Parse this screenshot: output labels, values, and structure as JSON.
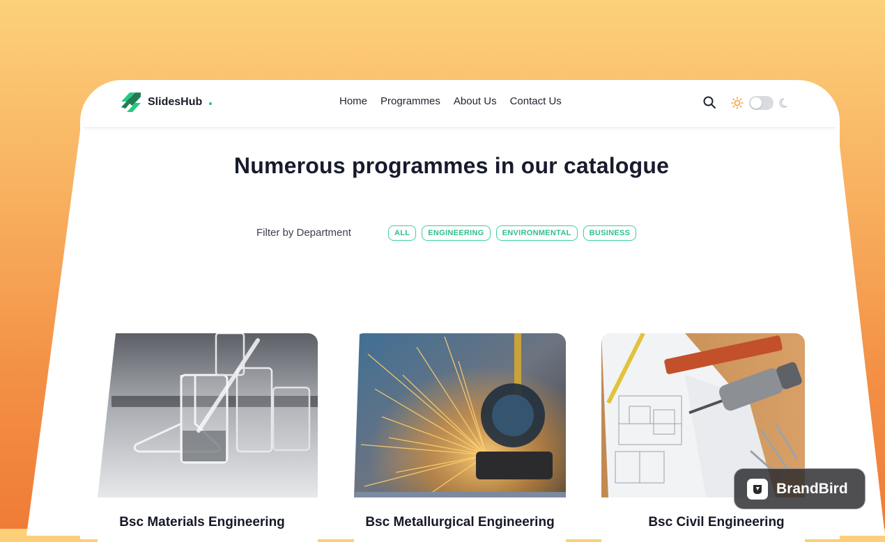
{
  "brand": {
    "name": "SlidesHub"
  },
  "nav": {
    "items": [
      "Home",
      "Programmes",
      "About Us",
      "Contact Us"
    ]
  },
  "headline": "Numerous programmes in our catalogue",
  "filter": {
    "label": "Filter by Department",
    "chips": [
      "ALL",
      "ENGINEERING",
      "ENVIRONMENTAL",
      "BUSINESS"
    ]
  },
  "cards": [
    {
      "title": "Bsc Materials Engineering"
    },
    {
      "title": "Bsc Metallurgical Engineering"
    },
    {
      "title": "Bsc Civil Engineering"
    }
  ],
  "watermark": {
    "text": "BrandBird"
  },
  "colors": {
    "accent": "#2ec27e",
    "chip_border": "#3ccf9b",
    "text_dark": "#171b2d"
  },
  "icons": [
    "search-icon",
    "sun-icon",
    "moon-icon",
    "theme-toggle"
  ],
  "theme_toggle": {
    "dark_mode": false
  }
}
